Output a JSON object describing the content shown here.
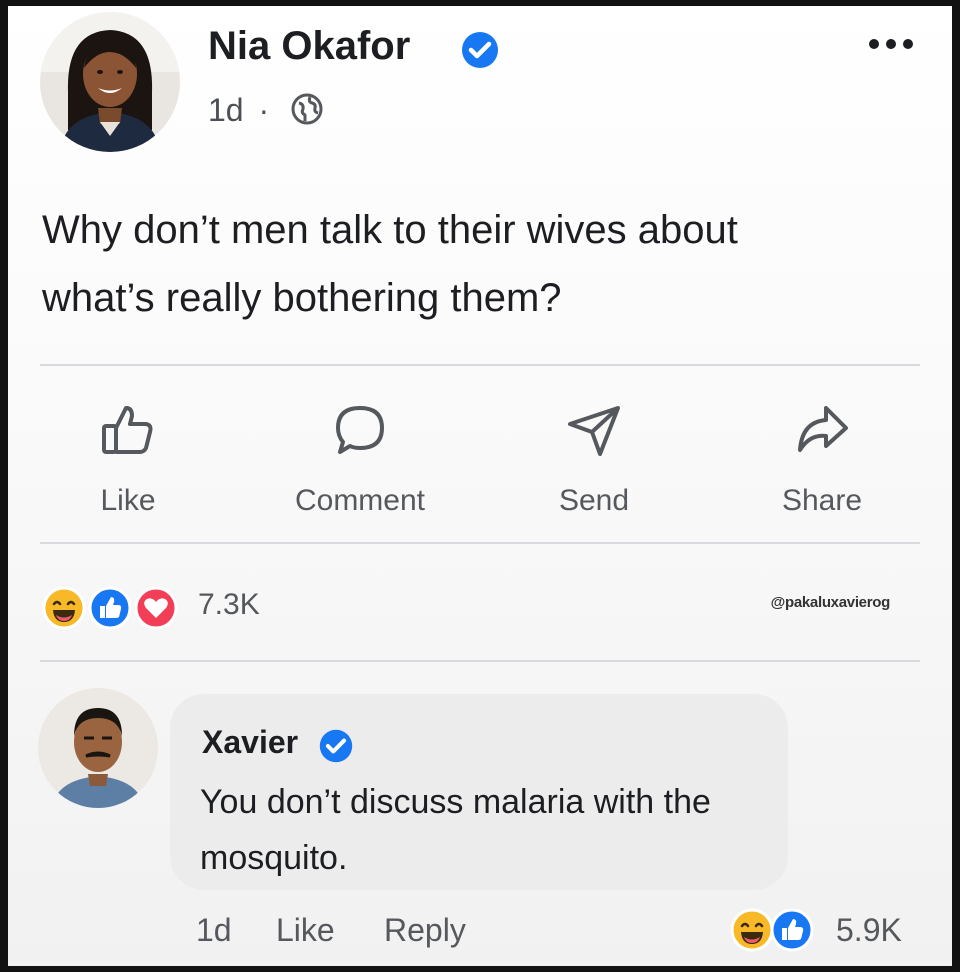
{
  "post": {
    "author": "Nia Okafor",
    "timestamp": "1d",
    "separator": "·",
    "privacy_icon": "globe-icon",
    "text_line1": "Why don’t men talk to their wives about",
    "text_line2": "what’s really bothering them?",
    "more_icon": "more-options-icon"
  },
  "actions": {
    "like": "Like",
    "comment": "Comment",
    "send": "Send",
    "share": "Share"
  },
  "reactions": {
    "icons": [
      "haha-icon",
      "like-icon",
      "love-icon"
    ],
    "count": "7.3K"
  },
  "watermark": "@pakaluxavierog",
  "comment": {
    "author": "Xavier",
    "text_line1": "You don’t discuss malaria with the",
    "text_line2": "mosquito.",
    "timestamp": "1d",
    "like": "Like",
    "reply": "Reply",
    "reaction_icons": [
      "haha-icon",
      "like-icon"
    ],
    "reaction_count": "5.9K"
  },
  "colors": {
    "verified_blue": "#1877f2",
    "love_red": "#f33e58",
    "haha_yellow": "#f7b928",
    "text_primary": "#1c1e21",
    "text_secondary": "#55585c"
  }
}
